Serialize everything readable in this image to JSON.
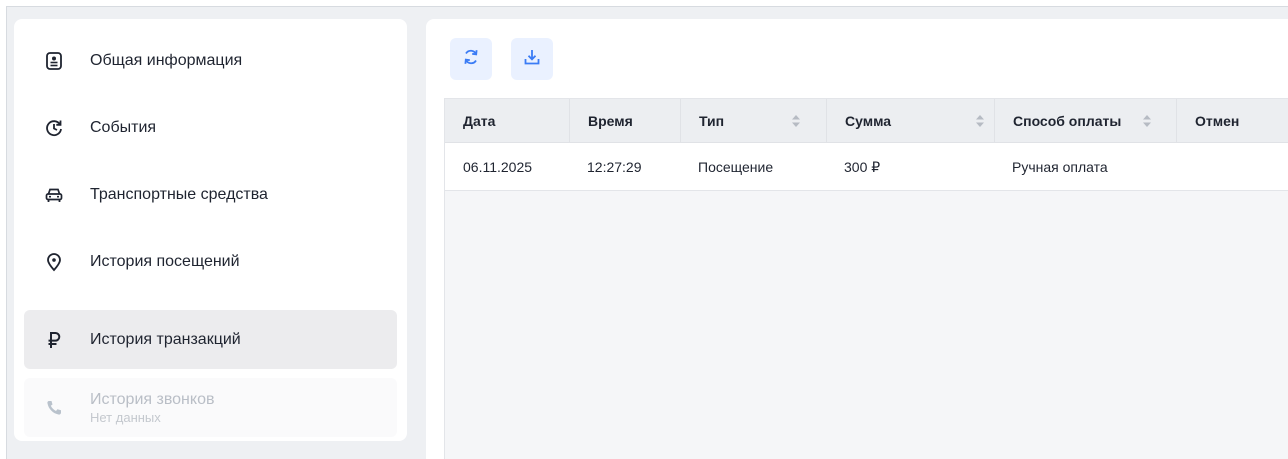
{
  "sidebar": {
    "items": [
      {
        "label": "Общая информация",
        "icon": "profile-card-icon"
      },
      {
        "label": "События",
        "icon": "clock-refresh-icon"
      },
      {
        "label": "Транспортные средства",
        "icon": "car-icon"
      },
      {
        "label": "История посещений",
        "icon": "location-pin-icon"
      },
      {
        "label": "История транзакций",
        "icon": "ruble-icon",
        "active": true
      },
      {
        "label": "История звонков",
        "sublabel": "Нет данных",
        "icon": "phone-icon",
        "disabled": true
      }
    ]
  },
  "toolbar": {
    "refresh_icon": "refresh-icon",
    "download_icon": "download-icon",
    "accent": "#3b7cf5"
  },
  "table": {
    "columns": [
      "Дата",
      "Время",
      "Тип",
      "Сумма",
      "Способ оплаты",
      "Отмен"
    ],
    "sortable": [
      false,
      false,
      true,
      true,
      true,
      false
    ],
    "rows": [
      [
        "06.11.2025",
        "12:27:29",
        "Посещение",
        "300 ₽",
        "Ручная оплата",
        ""
      ]
    ]
  }
}
